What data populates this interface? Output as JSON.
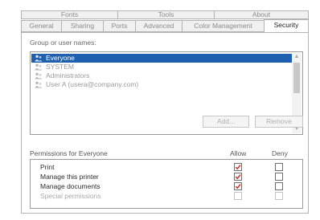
{
  "tabs": {
    "back_row": [
      {
        "label": "Fonts"
      },
      {
        "label": "Tools"
      },
      {
        "label": "About"
      }
    ],
    "front_row": [
      {
        "label": "General"
      },
      {
        "label": "Sharing"
      },
      {
        "label": "Ports"
      },
      {
        "label": "Advanced"
      },
      {
        "label": "Color Management"
      },
      {
        "label": "Security",
        "active": true
      }
    ]
  },
  "groups": {
    "label": "Group or user names:",
    "items": [
      {
        "label": "Everyone",
        "selected": true
      },
      {
        "label": "SYSTEM"
      },
      {
        "label": "Administrators"
      },
      {
        "label": "User A (usera@company.com)"
      }
    ]
  },
  "buttons": {
    "add": "Add...",
    "remove": "Remove"
  },
  "permissions": {
    "header": "Permissions for Everyone",
    "allow_label": "Allow",
    "deny_label": "Deny",
    "rows": [
      {
        "name": "Print",
        "allow": true,
        "deny": false,
        "enabled": true
      },
      {
        "name": "Manage this printer",
        "allow": true,
        "deny": false,
        "enabled": true
      },
      {
        "name": "Manage documents",
        "allow": true,
        "deny": false,
        "enabled": true
      },
      {
        "name": "Special permissions",
        "allow": false,
        "deny": false,
        "enabled": false
      }
    ]
  },
  "colors": {
    "selection": "#1f5fb0",
    "check": "#c0392b"
  },
  "icons": {
    "user": "user-group-icon",
    "scroll_up": "chevron-up-icon",
    "scroll_down": "chevron-down-icon"
  }
}
